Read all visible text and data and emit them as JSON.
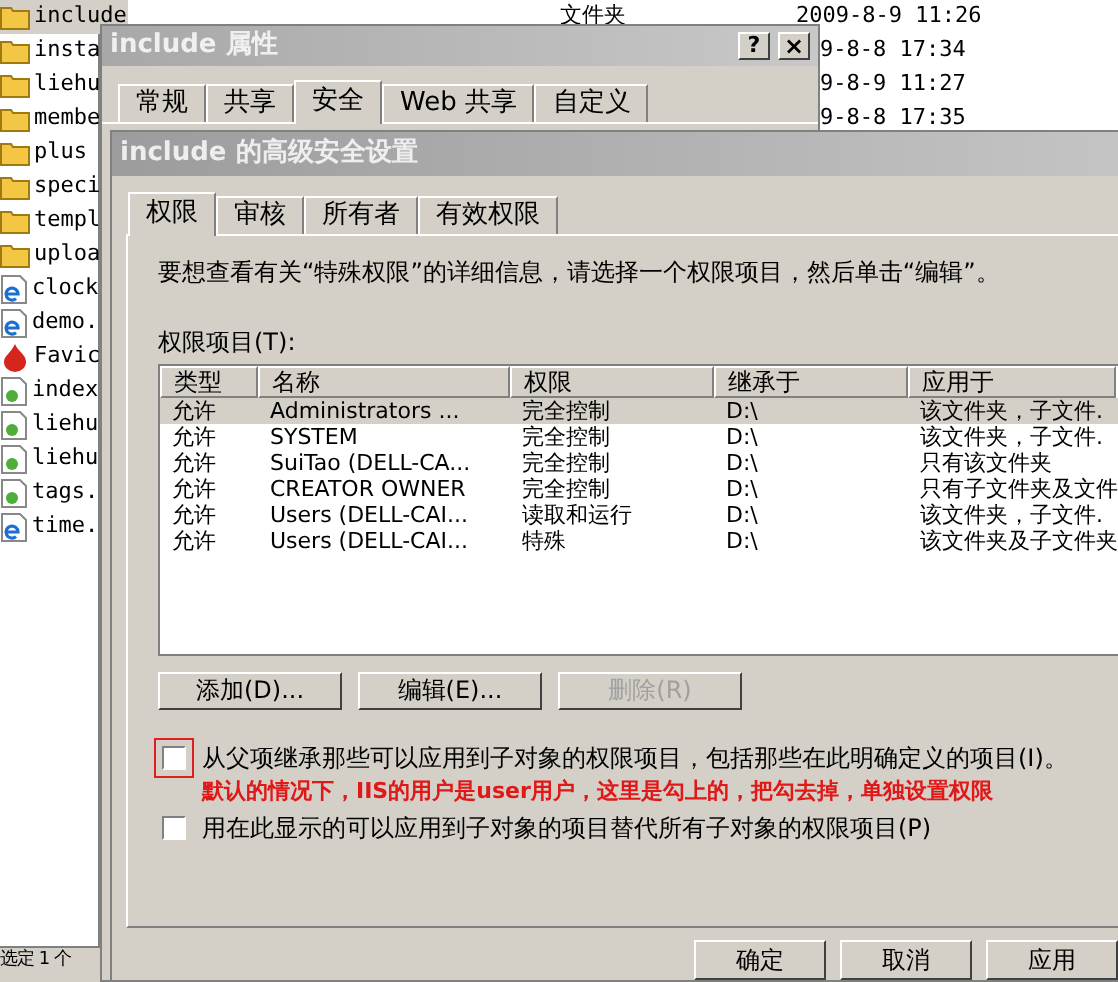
{
  "explorer": {
    "items": [
      {
        "name": "include",
        "kind": "folder",
        "selected": true
      },
      {
        "name": "insta",
        "kind": "folder",
        "selected": false
      },
      {
        "name": "liehu",
        "kind": "folder",
        "selected": false
      },
      {
        "name": "membe",
        "kind": "folder",
        "selected": false
      },
      {
        "name": "plus",
        "kind": "folder",
        "selected": false
      },
      {
        "name": "speci",
        "kind": "folder",
        "selected": false
      },
      {
        "name": "templ",
        "kind": "folder",
        "selected": false
      },
      {
        "name": "uploa",
        "kind": "folder",
        "selected": false
      },
      {
        "name": "clock",
        "kind": "web",
        "selected": false
      },
      {
        "name": "demo.",
        "kind": "web",
        "selected": false
      },
      {
        "name": "Favic",
        "kind": "favicon",
        "selected": false
      },
      {
        "name": "index",
        "kind": "script",
        "selected": false
      },
      {
        "name": "liehu",
        "kind": "script",
        "selected": false
      },
      {
        "name": "liehu",
        "kind": "script",
        "selected": false
      },
      {
        "name": "tags.",
        "kind": "script",
        "selected": false
      },
      {
        "name": "time.",
        "kind": "web",
        "selected": false
      }
    ],
    "details": [
      {
        "type": "文件夹",
        "modified": "2009-8-9 11:26"
      },
      {
        "modified": "9-8-8 17:34"
      },
      {
        "modified": "9-8-9 11:27"
      },
      {
        "modified": "9-8-8 17:35"
      }
    ],
    "status_bar": "选定 1 个"
  },
  "properties_dialog": {
    "title": "include 属性",
    "help_button": "?",
    "close_button": "×",
    "tabs": [
      {
        "label": "常规",
        "selected": false
      },
      {
        "label": "共享",
        "selected": false
      },
      {
        "label": "安全",
        "selected": true
      },
      {
        "label": "Web 共享",
        "selected": false
      },
      {
        "label": "自定义",
        "selected": false
      }
    ]
  },
  "advanced_dialog": {
    "title": "include 的高级安全设置",
    "tabs": [
      {
        "label": "权限",
        "selected": true
      },
      {
        "label": "审核",
        "selected": false
      },
      {
        "label": "所有者",
        "selected": false
      },
      {
        "label": "有效权限",
        "selected": false
      }
    ],
    "description": "要想查看有关“特殊权限”的详细信息，请选择一个权限项目，然后单击“编辑”。",
    "list_label": "权限项目(T):",
    "table": {
      "columns": [
        "类型",
        "名称",
        "权限",
        "继承于",
        "应用于"
      ],
      "rows": [
        {
          "cells": [
            "允许",
            "Administrators ...",
            "完全控制",
            "D:\\",
            "该文件夹，子文件."
          ],
          "selected": true
        },
        {
          "cells": [
            "允许",
            "SYSTEM",
            "完全控制",
            "D:\\",
            "该文件夹，子文件."
          ],
          "selected": false
        },
        {
          "cells": [
            "允许",
            "SuiTao (DELL-CA...",
            "完全控制",
            "D:\\",
            "只有该文件夹"
          ],
          "selected": false
        },
        {
          "cells": [
            "允许",
            "CREATOR OWNER",
            "完全控制",
            "D:\\",
            "只有子文件夹及文件"
          ],
          "selected": false
        },
        {
          "cells": [
            "允许",
            "Users (DELL-CAI...",
            "读取和运行",
            "D:\\",
            "该文件夹，子文件."
          ],
          "selected": false
        },
        {
          "cells": [
            "允许",
            "Users (DELL-CAI...",
            "特殊",
            "D:\\",
            "该文件夹及子文件夹"
          ],
          "selected": false
        }
      ]
    },
    "buttons": [
      {
        "label": "添加(D)...",
        "disabled": false
      },
      {
        "label": "编辑(E)...",
        "disabled": false
      },
      {
        "label": "删除(R)",
        "disabled": true
      }
    ],
    "options": [
      {
        "label": "从父项继承那些可以应用到子对象的权限项目，包括那些在此明确定义的项目(I)。",
        "checked": false,
        "highlighted": true
      },
      {
        "label": "用在此显示的可以应用到子对象的项目替代所有子对象的权限项目(P)",
        "checked": false,
        "highlighted": false
      }
    ],
    "annotation": "默认的情况下，IIS的用户是user用户，这里是勾上的，把勾去掉，单独设置权限",
    "footer_buttons": [
      "确定",
      "取消",
      "应用"
    ]
  }
}
